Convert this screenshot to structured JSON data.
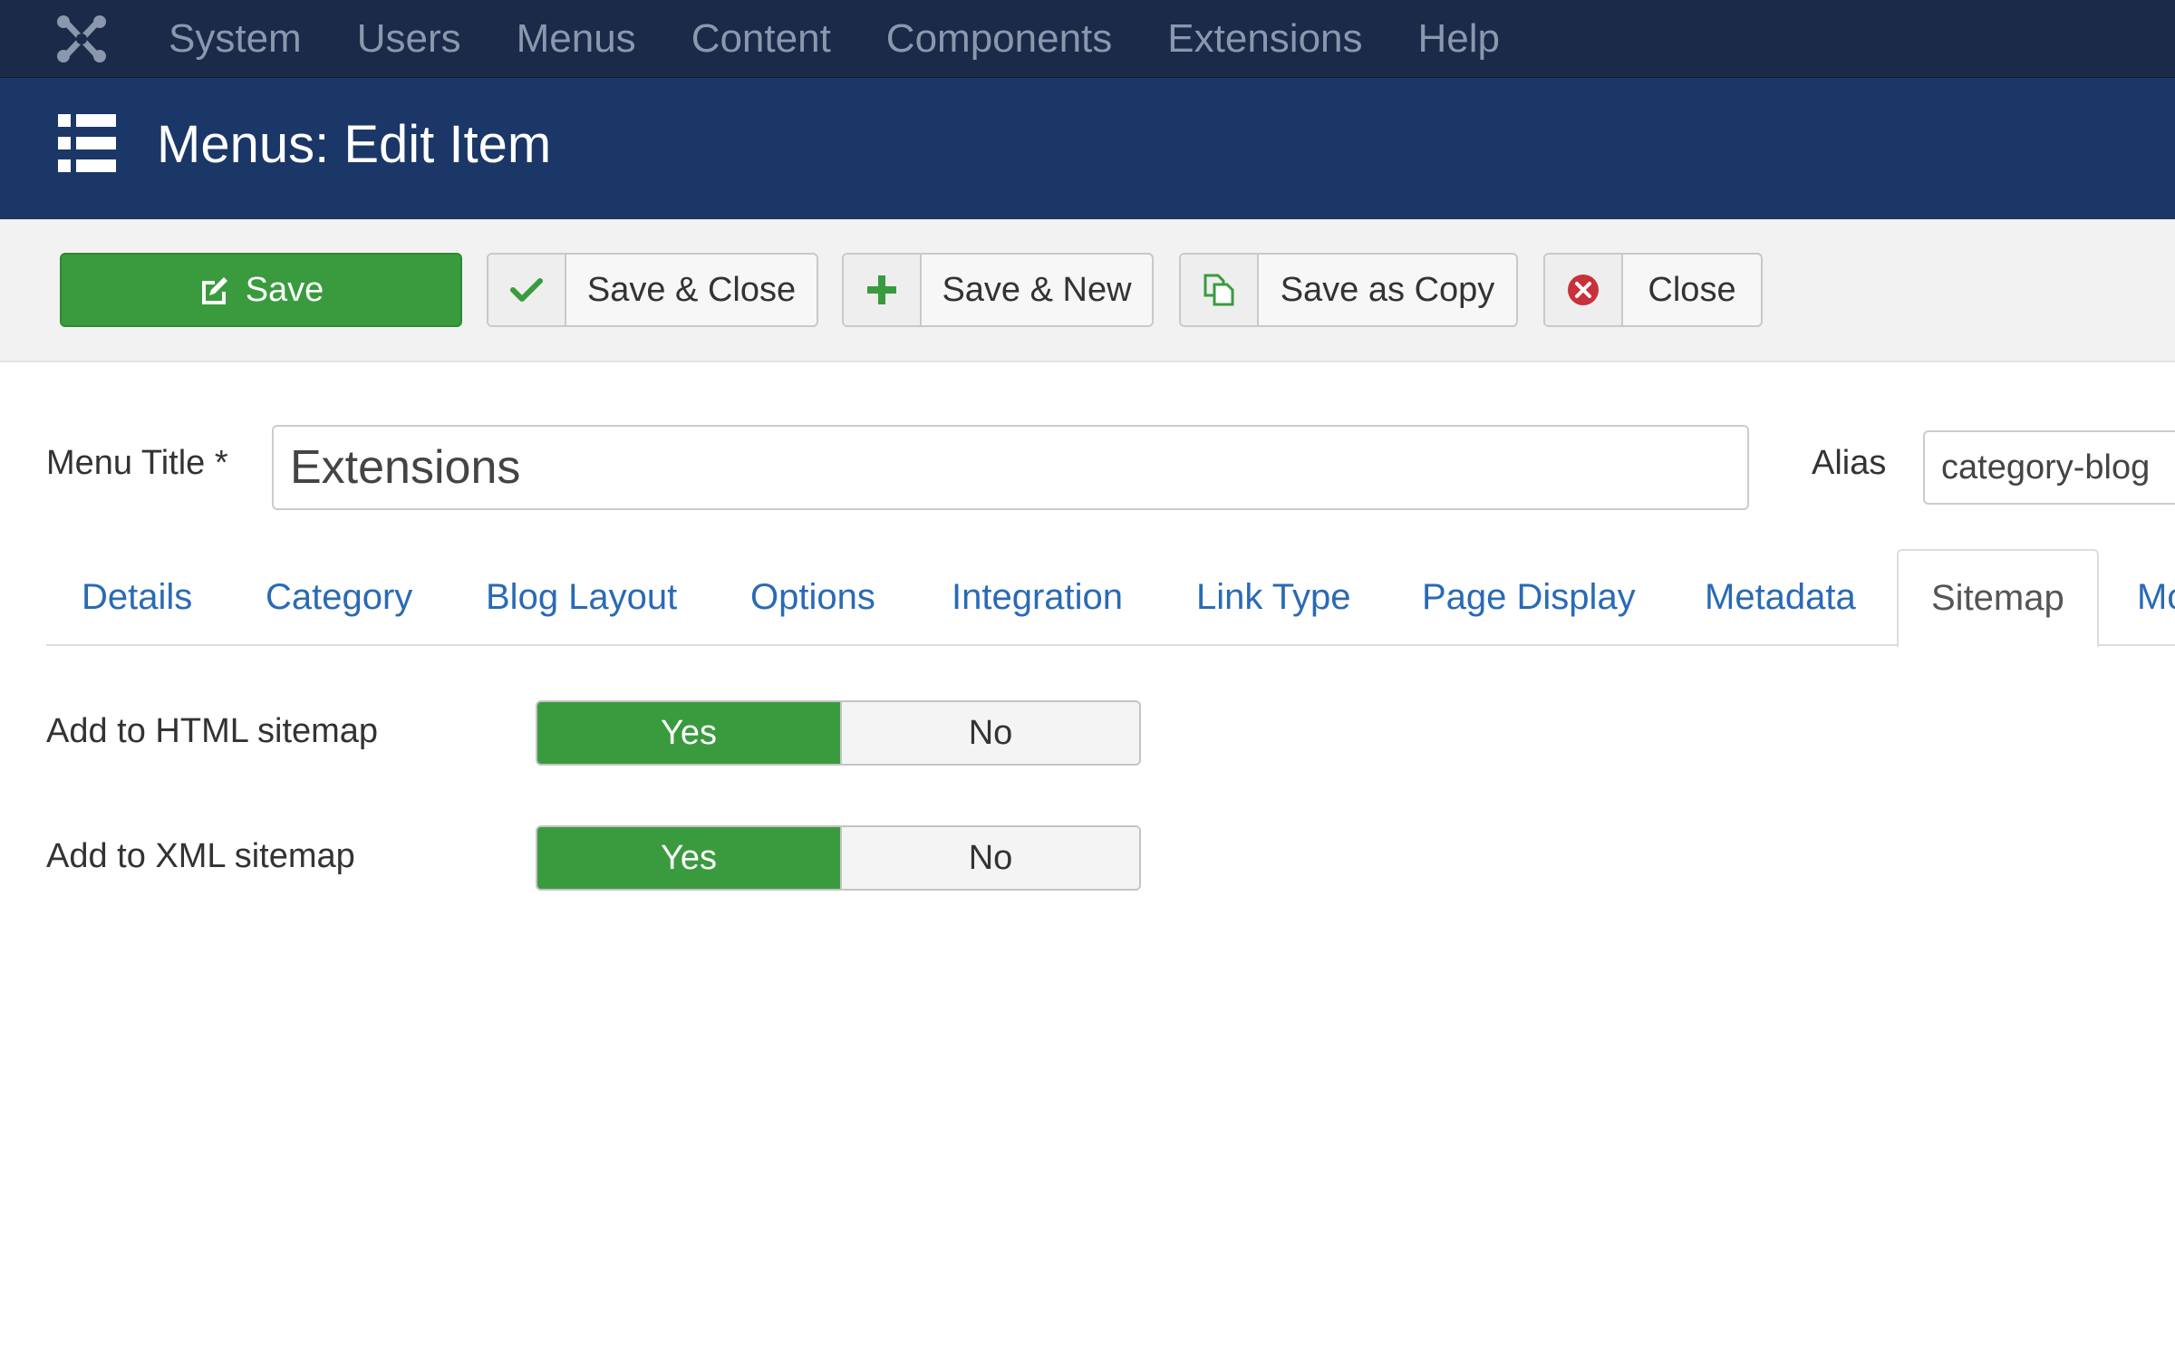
{
  "topnav": {
    "logo_icon": "joomla-logo-icon",
    "items": [
      "System",
      "Users",
      "Menus",
      "Content",
      "Components",
      "Extensions",
      "Help"
    ]
  },
  "header": {
    "icon": "list-icon",
    "title": "Menus: Edit Item"
  },
  "toolbar": {
    "save_label": "Save",
    "save_close_label": "Save & Close",
    "save_new_label": "Save & New",
    "save_copy_label": "Save as Copy",
    "close_label": "Close"
  },
  "form": {
    "menu_title_label": "Menu Title *",
    "menu_title_value": "Extensions",
    "alias_label": "Alias",
    "alias_value": "category-blog"
  },
  "tabs": [
    "Details",
    "Category",
    "Blog Layout",
    "Options",
    "Integration",
    "Link Type",
    "Page Display",
    "Metadata",
    "Sitemap",
    "Mo"
  ],
  "active_tab": "Sitemap",
  "sitemap": {
    "html": {
      "label": "Add to HTML sitemap",
      "yes": "Yes",
      "no": "No",
      "selected": "Yes"
    },
    "xml": {
      "label": "Add to XML sitemap",
      "yes": "Yes",
      "no": "No",
      "selected": "Yes"
    }
  },
  "colors": {
    "navbar": "#1a2a48",
    "header": "#1b3767",
    "success": "#3a9b3e",
    "link": "#2a6ab5",
    "danger": "#c8313a"
  }
}
